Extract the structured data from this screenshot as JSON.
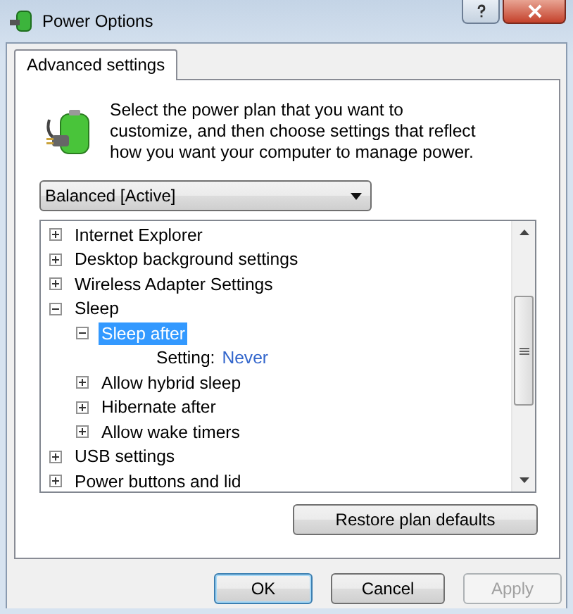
{
  "window": {
    "title": "Power Options"
  },
  "tabs": [
    {
      "label": "Advanced settings",
      "selected": true
    }
  ],
  "description": "Select the power plan that you want to customize, and then choose settings that reflect how you want your computer to manage power.",
  "plan_dropdown": {
    "value": "Balanced [Active]"
  },
  "tree": [
    {
      "kind": "group",
      "label": "Internet Explorer",
      "expanded": false,
      "selected": false
    },
    {
      "kind": "group",
      "label": "Desktop background settings",
      "expanded": false,
      "selected": false
    },
    {
      "kind": "group",
      "label": "Wireless Adapter Settings",
      "expanded": false,
      "selected": false
    },
    {
      "kind": "group",
      "label": "Sleep",
      "expanded": true,
      "selected": false,
      "children": [
        {
          "kind": "group",
          "label": "Sleep after",
          "expanded": true,
          "selected": true,
          "children": [
            {
              "kind": "setting",
              "label": "Setting:",
              "value": "Never"
            }
          ]
        },
        {
          "kind": "group",
          "label": "Allow hybrid sleep",
          "expanded": false,
          "selected": false
        },
        {
          "kind": "group",
          "label": "Hibernate after",
          "expanded": false,
          "selected": false
        },
        {
          "kind": "group",
          "label": "Allow wake timers",
          "expanded": false,
          "selected": false
        }
      ]
    },
    {
      "kind": "group",
      "label": "USB settings",
      "expanded": false,
      "selected": false
    },
    {
      "kind": "group",
      "label": "Power buttons and lid",
      "expanded": false,
      "selected": false
    }
  ],
  "restore_button": "Restore plan defaults",
  "buttons": [
    {
      "label": "OK",
      "default": true,
      "disabled": false
    },
    {
      "label": "Cancel",
      "default": false,
      "disabled": false
    },
    {
      "label": "Apply",
      "default": false,
      "disabled": true
    }
  ]
}
